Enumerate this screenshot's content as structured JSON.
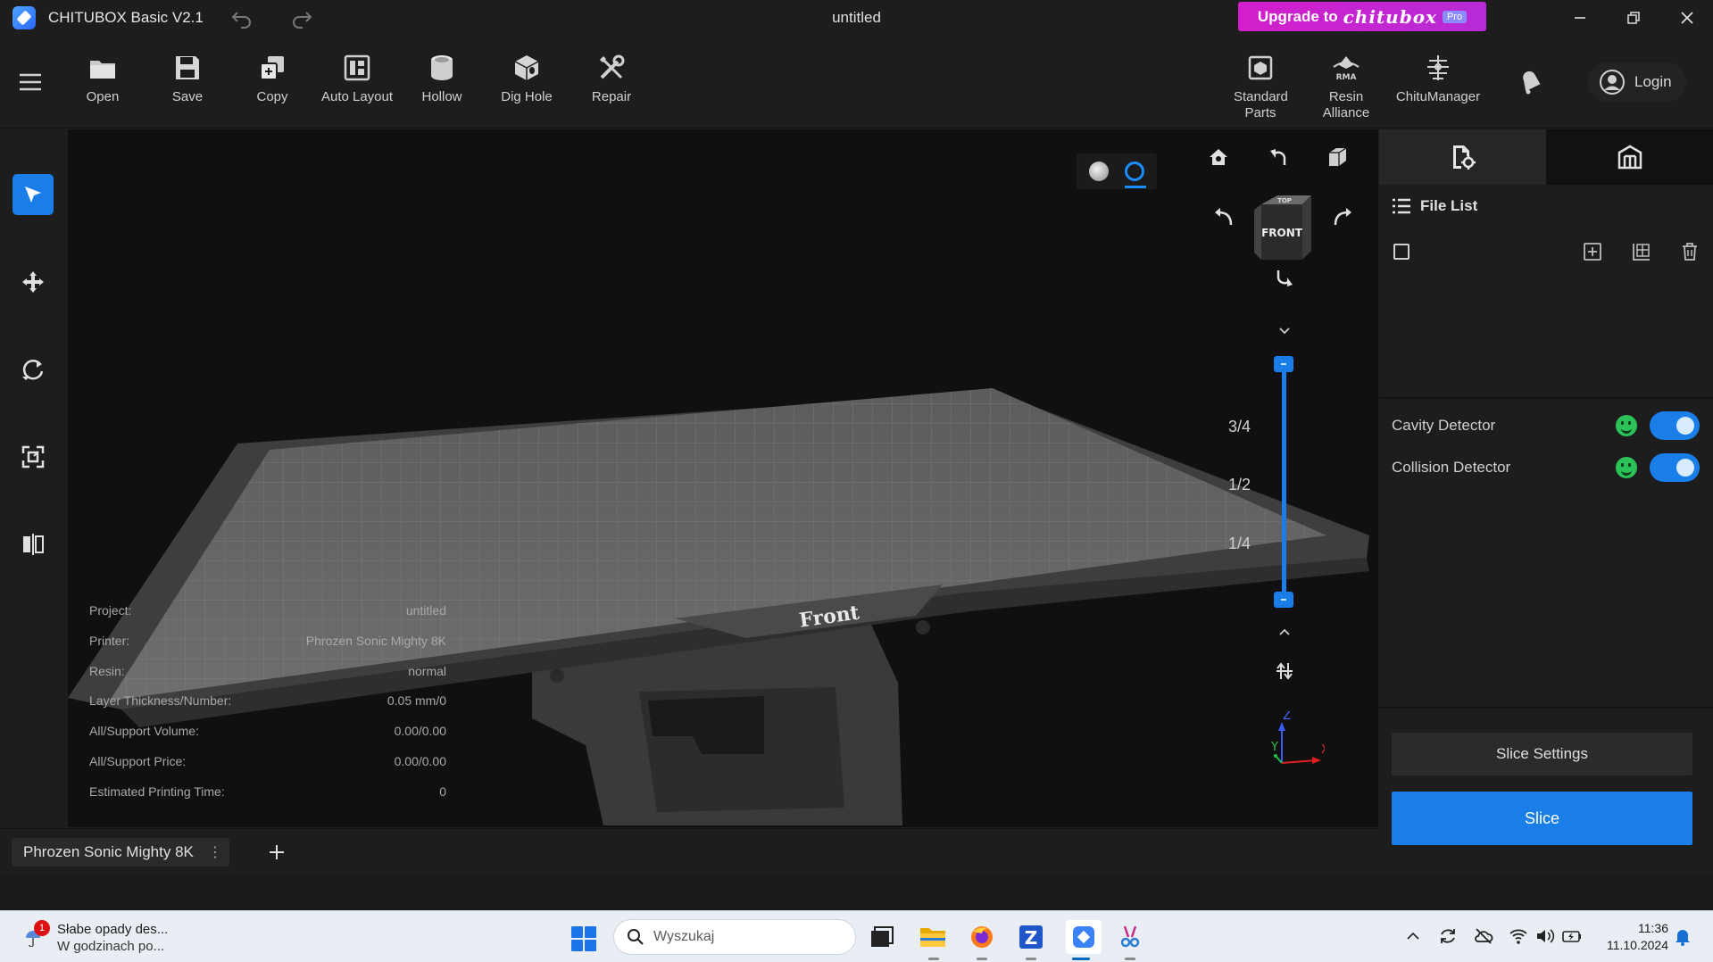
{
  "titlebar": {
    "app_title": "CHITUBOX Basic V2.1",
    "document_title": "untitled",
    "upgrade": {
      "prefix": "Upgrade to",
      "brand": "chitubox",
      "tier": "Pro"
    }
  },
  "toolbar": {
    "tools": [
      {
        "label": "Open",
        "icon": "folder-icon"
      },
      {
        "label": "Save",
        "icon": "save-icon"
      },
      {
        "label": "Copy",
        "icon": "copy-icon"
      },
      {
        "label": "Auto Layout",
        "icon": "auto-layout-icon"
      },
      {
        "label": "Hollow",
        "icon": "hollow-icon"
      },
      {
        "label": "Dig Hole",
        "icon": "dig-hole-icon"
      },
      {
        "label": "Repair",
        "icon": "repair-icon"
      }
    ],
    "right_tools": [
      {
        "label": "Standard Parts",
        "icon": "standard-parts-icon"
      },
      {
        "label": "Resin Alliance",
        "icon": "resin-alliance-icon"
      },
      {
        "label": "ChituManager",
        "icon": "chitumanager-icon"
      }
    ],
    "login_label": "Login"
  },
  "left_tools": [
    "select-icon",
    "move-icon",
    "rotate-icon",
    "scale-icon",
    "mirror-icon"
  ],
  "viewport": {
    "cube_faces": {
      "front": "FRONT",
      "top": "TOP"
    },
    "platform_label": "Front",
    "slider_marks": [
      "3/4",
      "1/2",
      "1/4"
    ],
    "axes": {
      "x": "X",
      "y": "Y",
      "z": "Z"
    },
    "info": [
      {
        "label": "Project:",
        "value": "untitled"
      },
      {
        "label": "Printer:",
        "value": "Phrozen Sonic Mighty 8K"
      },
      {
        "label": "Resin:",
        "value": "normal"
      },
      {
        "label": "Layer Thickness/Number:",
        "value": "0.05 mm/0"
      },
      {
        "label": "All/Support Volume:",
        "value": "0.00/0.00"
      },
      {
        "label": "All/Support Price:",
        "value": "0.00/0.00"
      },
      {
        "label": "Estimated Printing Time:",
        "value": "0"
      }
    ]
  },
  "right_panel": {
    "file_list_title": "File List",
    "detectors": [
      {
        "label": "Cavity Detector",
        "enabled": true
      },
      {
        "label": "Collision Detector",
        "enabled": true
      }
    ],
    "slice_settings_label": "Slice Settings",
    "slice_label": "Slice"
  },
  "bottom": {
    "printer_tab": "Phrozen Sonic Mighty 8K",
    "more_glyph": "⋮",
    "add_glyph": "+"
  },
  "taskbar": {
    "weather_line1": "Słabe opady des...",
    "weather_line2": "W godzinach po...",
    "weather_badge": "1",
    "search_placeholder": "Wyszukaj",
    "time": "11:36",
    "date": "11.10.2024"
  }
}
